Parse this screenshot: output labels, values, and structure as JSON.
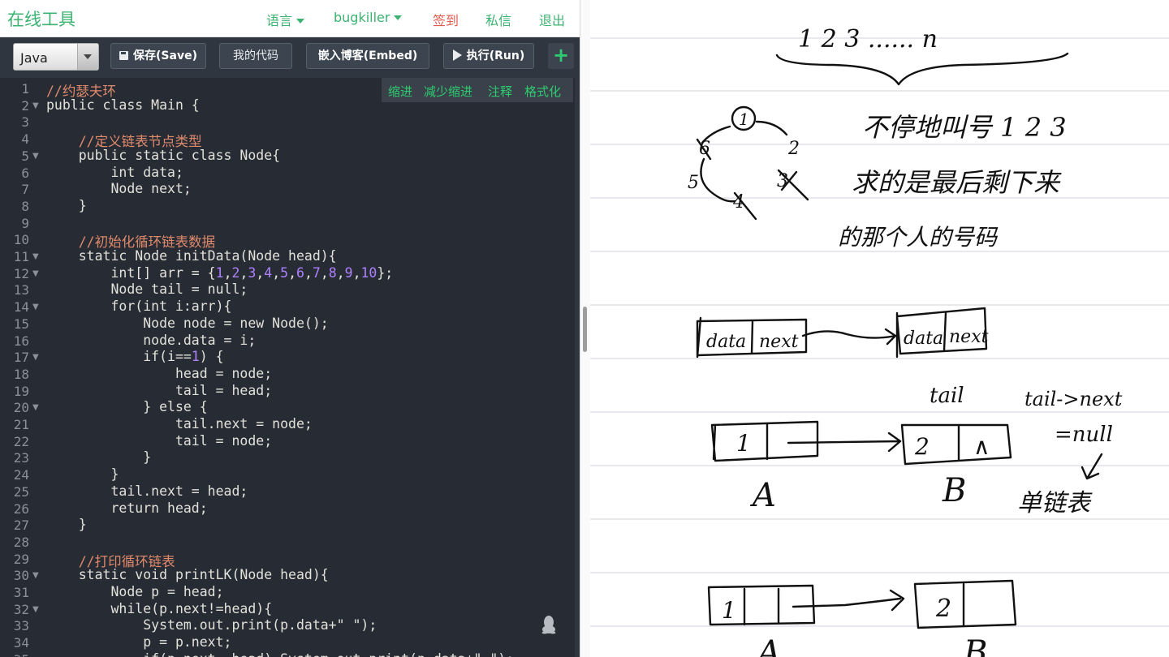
{
  "nav": {
    "site_title": "在线工具",
    "links": [
      "语言",
      "bugkiller",
      "签到",
      "私信",
      "退出"
    ]
  },
  "toolbar": {
    "language": "Java",
    "save_label": "保存(Save)",
    "my_code_label": "我的代码",
    "embed_label": "嵌入博客(Embed)",
    "run_label": "执行(Run)",
    "add_label": "+"
  },
  "editor": {
    "actions": [
      "缩进",
      "减少缩进",
      "注释",
      "格式化"
    ],
    "lines": [
      "//约瑟夫环",
      "public class Main {",
      "",
      "    //定义链表节点类型",
      "    public static class Node{",
      "        int data;",
      "        Node next;",
      "    }",
      "",
      "    //初始化循环链表数据",
      "    static Node initData(Node head){",
      "        int[] arr = {1,2,3,4,5,6,7,8,9,10};",
      "        Node tail = null;",
      "        for(int i:arr){",
      "            Node node = new Node();",
      "            node.data = i;",
      "            if(i==1) {",
      "                head = node;",
      "                tail = head;",
      "            } else {",
      "                tail.next = node;",
      "                tail = node;",
      "            }",
      "        }",
      "        tail.next = head;",
      "        return head;",
      "    }",
      "",
      "    //打印循环链表",
      "    static void printLK(Node head){",
      "        Node p = head;",
      "        while(p.next!=head){",
      "            System.out.print(p.data+\" \");",
      "            p = p.next;",
      "            if(p.next==head) System.out.print(p.data+\" \");"
    ],
    "fold_lines": [
      2,
      5,
      11,
      12,
      14,
      17,
      20,
      30,
      32
    ]
  },
  "notes": {
    "top_sequence": "1 2 3 ...... n",
    "circle_numbers": [
      "1",
      "2",
      "3",
      "4",
      "5",
      "6"
    ],
    "line1": "不停地叫号 1 2 3",
    "line2": "求的是最后剩下来",
    "line3": "的那个人的号码",
    "node_label_data": "data",
    "node_label_next": "next",
    "tail_label": "tail",
    "tail_next_label": "tail->next",
    "null_label": "=null",
    "node_a_value": "1",
    "node_b_value": "2",
    "null_symbol": "∧",
    "label_a": "A",
    "label_b": "B",
    "single_list_label": "单链表",
    "bottom_a_value": "1",
    "bottom_b_value": "2"
  }
}
